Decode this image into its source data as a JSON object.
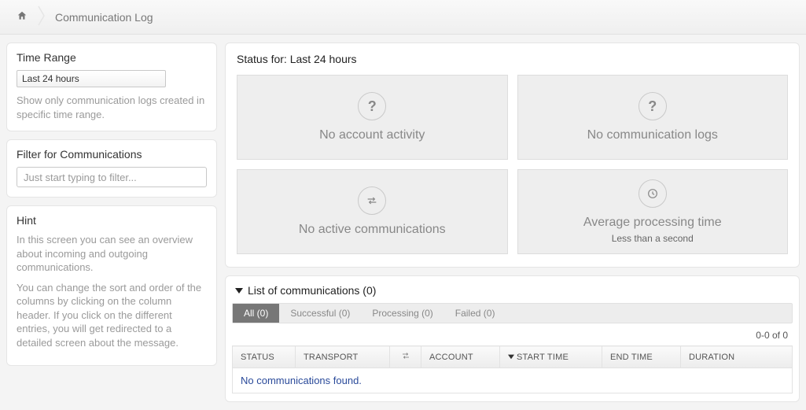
{
  "breadcrumb": {
    "page_label": "Communication Log"
  },
  "sidebar": {
    "time_range": {
      "title": "Time Range",
      "selected": "Last 24 hours",
      "help": "Show only communication logs created in specific time range."
    },
    "filter": {
      "title": "Filter for Communications",
      "placeholder": "Just start typing to filter..."
    },
    "hint": {
      "title": "Hint",
      "p1": "In this screen you can see an overview about incoming and outgoing communications.",
      "p2": "You can change the sort and order of the columns by clicking on the column header. If you click on the different entries, you will get redirected to a detailed screen about the message."
    }
  },
  "status": {
    "header": "Status for: Last 24 hours",
    "tiles": [
      {
        "title": "No account activity",
        "icon": "question"
      },
      {
        "title": "No communication logs",
        "icon": "question"
      },
      {
        "title": "No active communications",
        "icon": "swap"
      },
      {
        "title": "Average processing time",
        "sub": "Less than a second",
        "icon": "clock"
      }
    ]
  },
  "list": {
    "header": "List of communications (0)",
    "tabs": [
      {
        "label": "All (0)",
        "active": true
      },
      {
        "label": "Successful (0)",
        "active": false
      },
      {
        "label": "Processing (0)",
        "active": false
      },
      {
        "label": "Failed (0)",
        "active": false
      }
    ],
    "pager": "0-0 of 0",
    "columns": {
      "status": "STATUS",
      "transport": "TRANSPORT",
      "direction": "",
      "account": "ACCOUNT",
      "start_time": "START TIME",
      "end_time": "END TIME",
      "duration": "DURATION"
    },
    "empty_message": "No communications found."
  }
}
